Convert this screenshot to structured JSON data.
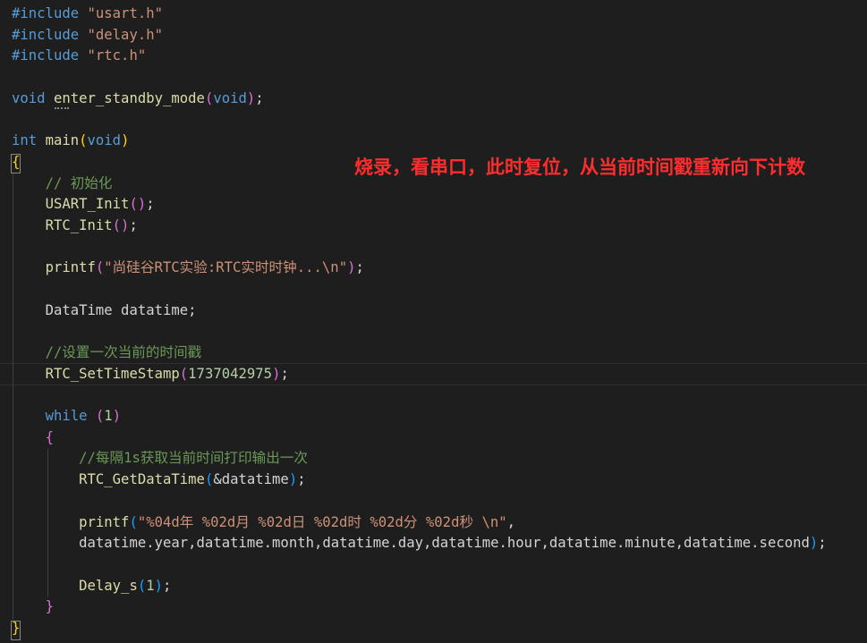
{
  "editor": {
    "lines": [
      [
        {
          "t": "#include ",
          "c": "pp"
        },
        {
          "t": "\"usart.h\"",
          "c": "str"
        }
      ],
      [
        {
          "t": "#include ",
          "c": "pp"
        },
        {
          "t": "\"delay.h\"",
          "c": "str"
        }
      ],
      [
        {
          "t": "#include ",
          "c": "pp"
        },
        {
          "t": "\"rtc.h\"",
          "c": "str"
        }
      ],
      [],
      [
        {
          "t": "void",
          "c": "kw"
        },
        {
          "t": " ",
          "c": "plain"
        },
        {
          "t": "enter_standby_mode",
          "c": "fn"
        },
        {
          "t": "(",
          "c": "brace-pink"
        },
        {
          "t": "void",
          "c": "kw"
        },
        {
          "t": ")",
          "c": "brace-pink"
        },
        {
          "t": ";",
          "c": "plain"
        }
      ],
      [],
      [
        {
          "t": "int",
          "c": "kw"
        },
        {
          "t": " ",
          "c": "plain"
        },
        {
          "t": "main",
          "c": "fn"
        },
        {
          "t": "(",
          "c": "brace-gold"
        },
        {
          "t": "void",
          "c": "kw"
        },
        {
          "t": ")",
          "c": "brace-gold"
        }
      ],
      [
        {
          "t": "{",
          "c": "brace-gold"
        }
      ],
      [
        {
          "t": "    ",
          "c": "plain"
        },
        {
          "t": "// 初始化",
          "c": "com"
        }
      ],
      [
        {
          "t": "    ",
          "c": "plain"
        },
        {
          "t": "USART_Init",
          "c": "fn"
        },
        {
          "t": "()",
          "c": "brace-pink"
        },
        {
          "t": ";",
          "c": "plain"
        }
      ],
      [
        {
          "t": "    ",
          "c": "plain"
        },
        {
          "t": "RTC_Init",
          "c": "fn"
        },
        {
          "t": "()",
          "c": "brace-pink"
        },
        {
          "t": ";",
          "c": "plain"
        }
      ],
      [],
      [
        {
          "t": "    ",
          "c": "plain"
        },
        {
          "t": "printf",
          "c": "fn"
        },
        {
          "t": "(",
          "c": "brace-pink"
        },
        {
          "t": "\"尚硅谷RTC实验:RTC实时时钟...\\n\"",
          "c": "str"
        },
        {
          "t": ")",
          "c": "brace-pink"
        },
        {
          "t": ";",
          "c": "plain"
        }
      ],
      [],
      [
        {
          "t": "    ",
          "c": "plain"
        },
        {
          "t": "DataTime datatime;",
          "c": "plain"
        }
      ],
      [],
      [
        {
          "t": "    ",
          "c": "plain"
        },
        {
          "t": "//设置一次当前的时间戳",
          "c": "com"
        }
      ],
      [
        {
          "t": "    ",
          "c": "plain"
        },
        {
          "t": "RTC_SetTimeStamp",
          "c": "fn"
        },
        {
          "t": "(",
          "c": "brace-pink"
        },
        {
          "t": "1737042975",
          "c": "num"
        },
        {
          "t": ")",
          "c": "brace-pink"
        },
        {
          "t": ";",
          "c": "plain"
        }
      ],
      [],
      [
        {
          "t": "    ",
          "c": "plain"
        },
        {
          "t": "while",
          "c": "kw"
        },
        {
          "t": " ",
          "c": "plain"
        },
        {
          "t": "(",
          "c": "brace-pink"
        },
        {
          "t": "1",
          "c": "num"
        },
        {
          "t": ")",
          "c": "brace-pink"
        }
      ],
      [
        {
          "t": "    ",
          "c": "plain"
        },
        {
          "t": "{",
          "c": "brace-pink"
        }
      ],
      [
        {
          "t": "        ",
          "c": "plain"
        },
        {
          "t": "//每隔1s获取当前时间打印输出一次",
          "c": "com"
        }
      ],
      [
        {
          "t": "        ",
          "c": "plain"
        },
        {
          "t": "RTC_GetDataTime",
          "c": "fn"
        },
        {
          "t": "(",
          "c": "brace-blue"
        },
        {
          "t": "&datatime",
          "c": "plain"
        },
        {
          "t": ")",
          "c": "brace-blue"
        },
        {
          "t": ";",
          "c": "plain"
        }
      ],
      [],
      [
        {
          "t": "        ",
          "c": "plain"
        },
        {
          "t": "printf",
          "c": "fn"
        },
        {
          "t": "(",
          "c": "brace-blue"
        },
        {
          "t": "\"%04d年 %02d月 %02d日 %02d时 %02d分 %02d秒 \\n\"",
          "c": "str"
        },
        {
          "t": ",",
          "c": "plain"
        }
      ],
      [
        {
          "t": "        ",
          "c": "plain"
        },
        {
          "t": "datatime.year,datatime.month,datatime.day,datatime.hour,datatime.minute,datatime.second",
          "c": "plain"
        },
        {
          "t": ")",
          "c": "brace-blue"
        },
        {
          "t": ";",
          "c": "plain"
        }
      ],
      [],
      [
        {
          "t": "        ",
          "c": "plain"
        },
        {
          "t": "Delay_s",
          "c": "fn"
        },
        {
          "t": "(",
          "c": "brace-blue"
        },
        {
          "t": "1",
          "c": "num"
        },
        {
          "t": ")",
          "c": "brace-blue"
        },
        {
          "t": ";",
          "c": "plain"
        }
      ],
      [
        {
          "t": "    ",
          "c": "plain"
        },
        {
          "t": "}",
          "c": "brace-pink"
        }
      ],
      [
        {
          "t": "}",
          "c": "brace-gold"
        }
      ]
    ],
    "current_line": 17
  },
  "annotation": {
    "text": "烧录，看串口，此时复位，从当前时间戳重新向下计数",
    "color": "#ff2d2d"
  },
  "theme": {
    "background": "#1e1e1e",
    "keyword": "#569cd6",
    "string": "#ce9178",
    "comment": "#6a9955",
    "function": "#dcdcaa",
    "number": "#b5cea8"
  }
}
